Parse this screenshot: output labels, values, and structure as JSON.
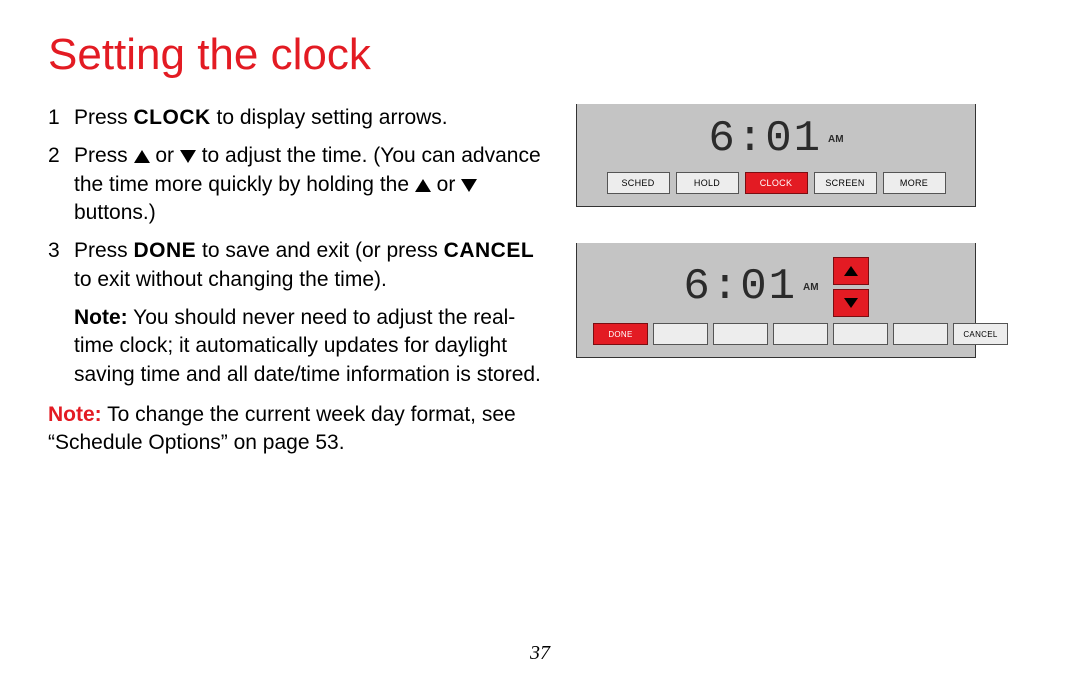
{
  "title": "Setting the clock",
  "steps": {
    "s1_pre": "Press ",
    "s1_btn": "CLOCK",
    "s1_post": " to display setting arrows.",
    "s2_pre": "Press ",
    "s2_mid": " or ",
    "s2_post": " to adjust the time. (You can advance the time more quickly by holding the ",
    "s2_mid2": " or ",
    "s2_end": " buttons.)",
    "s3_pre": "Press ",
    "s3_btn1": "DONE",
    "s3_mid": " to save and exit (or press ",
    "s3_btn2": "CANCEL",
    "s3_post": " to exit without changing the time).",
    "s3_note_label": "Note:",
    "s3_note_body": " You should never need to adjust the real-time clock; it automatically updates for daylight saving time and all date/time information is stored."
  },
  "extra_note_label": "Note:",
  "extra_note_body": " To change the current week day format, see “Schedule Options” on page 53.",
  "page_number": "37",
  "thermo1": {
    "time": "6:01",
    "ampm": "AM",
    "buttons": [
      "SCHED",
      "HOLD",
      "CLOCK",
      "SCREEN",
      "MORE"
    ]
  },
  "thermo2": {
    "time": "6:01",
    "ampm": "AM",
    "done": "DONE",
    "cancel": "CANCEL"
  }
}
